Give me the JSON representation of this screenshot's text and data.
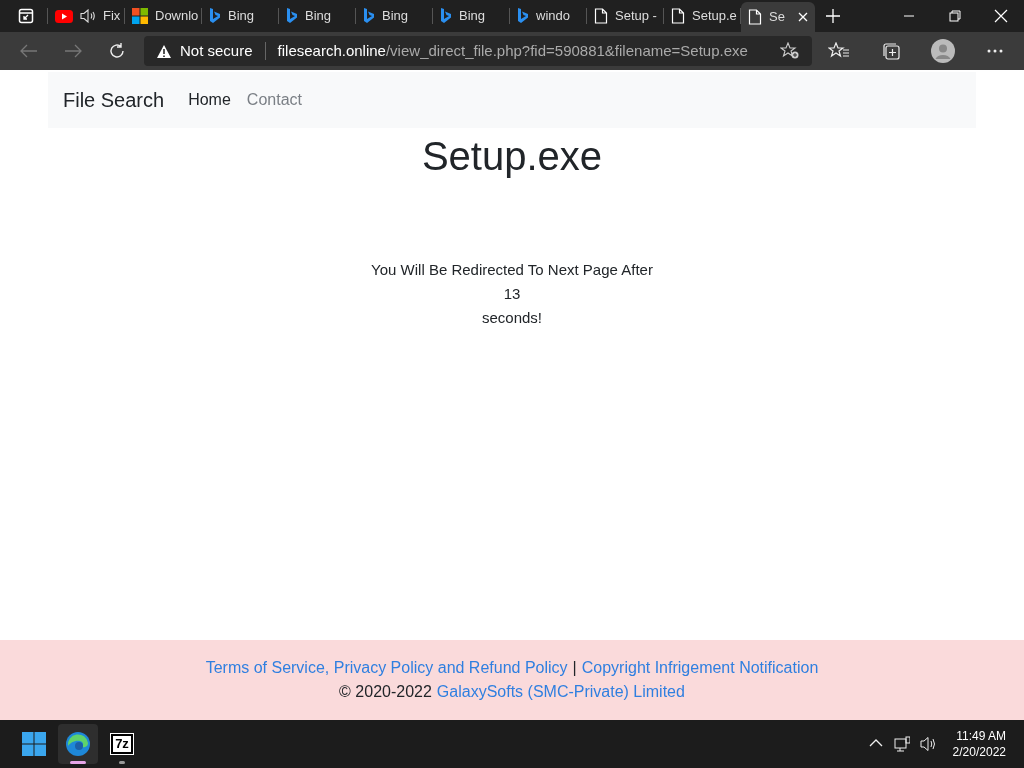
{
  "tabs": [
    {
      "kind": "app",
      "selected": false,
      "audio": false
    },
    {
      "kind": "youtube",
      "title": "Fix",
      "selected": false,
      "audio": true
    },
    {
      "kind": "microsoft",
      "title": "Downlo",
      "selected": false,
      "audio": false
    },
    {
      "kind": "bing",
      "title": "Bing",
      "selected": false,
      "audio": false
    },
    {
      "kind": "bing",
      "title": "Bing",
      "selected": false,
      "audio": false
    },
    {
      "kind": "bing",
      "title": "Bing",
      "selected": false,
      "audio": false
    },
    {
      "kind": "bing",
      "title": "Bing",
      "selected": false,
      "audio": false
    },
    {
      "kind": "bing",
      "title": "windo",
      "selected": false,
      "audio": false
    },
    {
      "kind": "page",
      "title": "Setup -",
      "selected": false,
      "audio": false
    },
    {
      "kind": "page",
      "title": "Setup.e",
      "selected": false,
      "audio": false
    },
    {
      "kind": "page",
      "title": "Se",
      "selected": true,
      "audio": false
    }
  ],
  "address_bar": {
    "security": "Not secure",
    "host": "filesearch.online",
    "path": "/view_direct_file.php?fid=590881&filename=Setup.exe"
  },
  "navbar": {
    "brand": "File Search",
    "links": [
      {
        "label": "Home",
        "selected": true
      },
      {
        "label": "Contact",
        "selected": false
      }
    ]
  },
  "heading": "Setup.exe",
  "redirect": {
    "line_1": "You Will Be Redirected To Next Page After",
    "countdown": "13",
    "line_2": "seconds!"
  },
  "footer": {
    "links_1": [
      {
        "label": "Terms of Service, Privacy Policy and Refund Policy"
      },
      {
        "label": "Copyright Infrigement Notification"
      }
    ],
    "separator": "|",
    "copyright": "© 2020-2022",
    "company": "GalaxySofts (SMC-Private) Limited"
  },
  "taskbar": {
    "apps": [
      {
        "kind": "edge",
        "selected": true
      },
      {
        "kind": "archiver",
        "label": "7z",
        "selected": false
      }
    ],
    "time": "11:49 AM",
    "date": "2/20/2022"
  }
}
